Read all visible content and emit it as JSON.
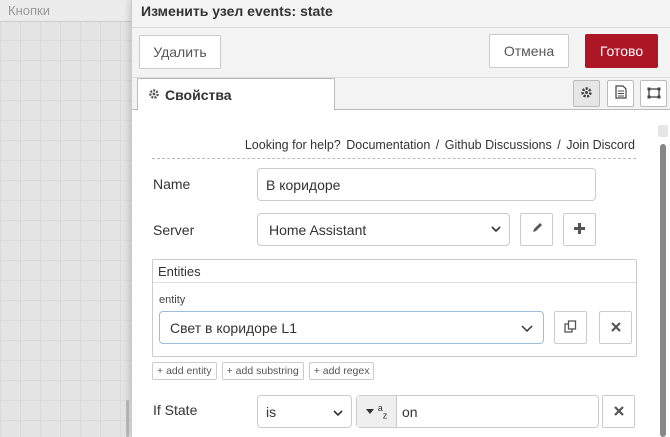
{
  "palette": {
    "header": "Кнопки"
  },
  "tray": {
    "title": "Изменить узел events: state",
    "buttons": {
      "delete": "Удалить",
      "cancel": "Отмена",
      "done": "Готово"
    },
    "tab": {
      "label": "Свойства"
    }
  },
  "help": {
    "prefix": "Looking for help?",
    "links": [
      "Documentation",
      "Github Discussions",
      "Join Discord"
    ],
    "separator": "/"
  },
  "form": {
    "name": {
      "label": "Name",
      "value": "В коридоре"
    },
    "server": {
      "label": "Server",
      "value": "Home Assistant"
    },
    "entities": {
      "title": "Entities",
      "entity_label": "entity",
      "entity_value": "Свет в коридоре L1",
      "chips": [
        "add entity",
        "add substring",
        "add regex"
      ]
    },
    "if_state": {
      "label": "If State",
      "operator": "is",
      "type_label": "a",
      "type_sub": "z",
      "value": "on"
    }
  },
  "colors": {
    "accent": "#ad1625"
  }
}
